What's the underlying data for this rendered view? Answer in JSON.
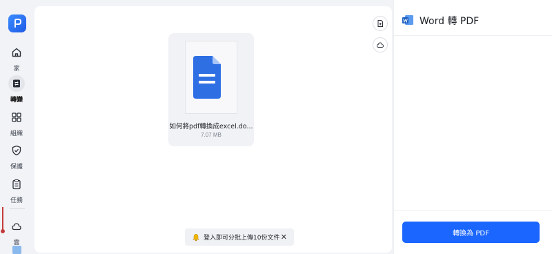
{
  "sidebar": {
    "logo": "app-logo",
    "items": [
      {
        "label": "家",
        "icon": "home-icon"
      },
      {
        "label": "轉變",
        "icon": "convert-icon",
        "active": true
      },
      {
        "label": "組織",
        "icon": "grid-icon"
      },
      {
        "label": "保護",
        "icon": "shield-icon"
      },
      {
        "label": "任務",
        "icon": "clipboard-icon"
      },
      {
        "label": "雲",
        "icon": "cloud-icon"
      }
    ]
  },
  "main": {
    "actions": [
      {
        "icon": "add-file-icon"
      },
      {
        "icon": "cloud-upload-icon"
      }
    ],
    "file": {
      "name": "如何將pdf轉換成excel.do...",
      "size": "7.07 MB",
      "icon": "document-icon",
      "icon_color": "#2f6fe4"
    },
    "toast": {
      "icon": "bell-icon",
      "text": "登入即可分批上傳10份文件",
      "close": "✕"
    }
  },
  "right_panel": {
    "title": "Word 轉 PDF",
    "icon": "word-icon",
    "convert_button": "轉換為 PDF",
    "accent": "#1a66ff"
  }
}
